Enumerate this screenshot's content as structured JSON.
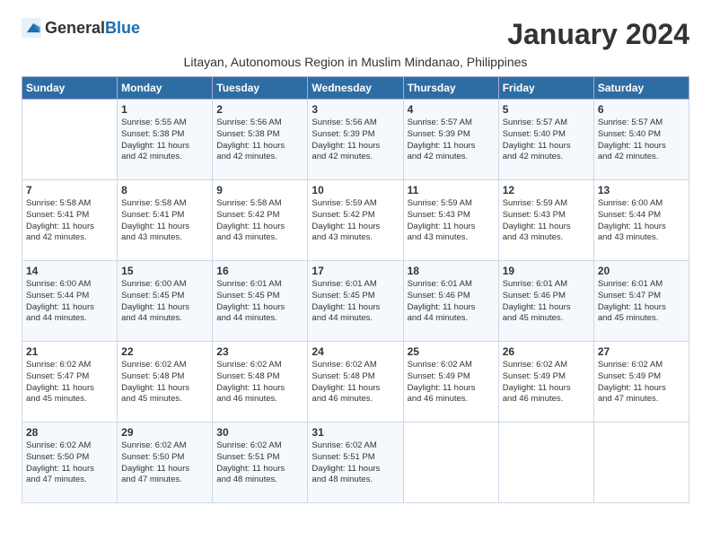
{
  "logo": {
    "general": "General",
    "blue": "Blue"
  },
  "title": "January 2024",
  "subtitle": "Litayan, Autonomous Region in Muslim Mindanao, Philippines",
  "days_of_week": [
    "Sunday",
    "Monday",
    "Tuesday",
    "Wednesday",
    "Thursday",
    "Friday",
    "Saturday"
  ],
  "weeks": [
    [
      {
        "day": "",
        "info": ""
      },
      {
        "day": "1",
        "info": "Sunrise: 5:55 AM\nSunset: 5:38 PM\nDaylight: 11 hours\nand 42 minutes."
      },
      {
        "day": "2",
        "info": "Sunrise: 5:56 AM\nSunset: 5:38 PM\nDaylight: 11 hours\nand 42 minutes."
      },
      {
        "day": "3",
        "info": "Sunrise: 5:56 AM\nSunset: 5:39 PM\nDaylight: 11 hours\nand 42 minutes."
      },
      {
        "day": "4",
        "info": "Sunrise: 5:57 AM\nSunset: 5:39 PM\nDaylight: 11 hours\nand 42 minutes."
      },
      {
        "day": "5",
        "info": "Sunrise: 5:57 AM\nSunset: 5:40 PM\nDaylight: 11 hours\nand 42 minutes."
      },
      {
        "day": "6",
        "info": "Sunrise: 5:57 AM\nSunset: 5:40 PM\nDaylight: 11 hours\nand 42 minutes."
      }
    ],
    [
      {
        "day": "7",
        "info": "Sunrise: 5:58 AM\nSunset: 5:41 PM\nDaylight: 11 hours\nand 42 minutes."
      },
      {
        "day": "8",
        "info": "Sunrise: 5:58 AM\nSunset: 5:41 PM\nDaylight: 11 hours\nand 43 minutes."
      },
      {
        "day": "9",
        "info": "Sunrise: 5:58 AM\nSunset: 5:42 PM\nDaylight: 11 hours\nand 43 minutes."
      },
      {
        "day": "10",
        "info": "Sunrise: 5:59 AM\nSunset: 5:42 PM\nDaylight: 11 hours\nand 43 minutes."
      },
      {
        "day": "11",
        "info": "Sunrise: 5:59 AM\nSunset: 5:43 PM\nDaylight: 11 hours\nand 43 minutes."
      },
      {
        "day": "12",
        "info": "Sunrise: 5:59 AM\nSunset: 5:43 PM\nDaylight: 11 hours\nand 43 minutes."
      },
      {
        "day": "13",
        "info": "Sunrise: 6:00 AM\nSunset: 5:44 PM\nDaylight: 11 hours\nand 43 minutes."
      }
    ],
    [
      {
        "day": "14",
        "info": "Sunrise: 6:00 AM\nSunset: 5:44 PM\nDaylight: 11 hours\nand 44 minutes."
      },
      {
        "day": "15",
        "info": "Sunrise: 6:00 AM\nSunset: 5:45 PM\nDaylight: 11 hours\nand 44 minutes."
      },
      {
        "day": "16",
        "info": "Sunrise: 6:01 AM\nSunset: 5:45 PM\nDaylight: 11 hours\nand 44 minutes."
      },
      {
        "day": "17",
        "info": "Sunrise: 6:01 AM\nSunset: 5:45 PM\nDaylight: 11 hours\nand 44 minutes."
      },
      {
        "day": "18",
        "info": "Sunrise: 6:01 AM\nSunset: 5:46 PM\nDaylight: 11 hours\nand 44 minutes."
      },
      {
        "day": "19",
        "info": "Sunrise: 6:01 AM\nSunset: 5:46 PM\nDaylight: 11 hours\nand 45 minutes."
      },
      {
        "day": "20",
        "info": "Sunrise: 6:01 AM\nSunset: 5:47 PM\nDaylight: 11 hours\nand 45 minutes."
      }
    ],
    [
      {
        "day": "21",
        "info": "Sunrise: 6:02 AM\nSunset: 5:47 PM\nDaylight: 11 hours\nand 45 minutes."
      },
      {
        "day": "22",
        "info": "Sunrise: 6:02 AM\nSunset: 5:48 PM\nDaylight: 11 hours\nand 45 minutes."
      },
      {
        "day": "23",
        "info": "Sunrise: 6:02 AM\nSunset: 5:48 PM\nDaylight: 11 hours\nand 46 minutes."
      },
      {
        "day": "24",
        "info": "Sunrise: 6:02 AM\nSunset: 5:48 PM\nDaylight: 11 hours\nand 46 minutes."
      },
      {
        "day": "25",
        "info": "Sunrise: 6:02 AM\nSunset: 5:49 PM\nDaylight: 11 hours\nand 46 minutes."
      },
      {
        "day": "26",
        "info": "Sunrise: 6:02 AM\nSunset: 5:49 PM\nDaylight: 11 hours\nand 46 minutes."
      },
      {
        "day": "27",
        "info": "Sunrise: 6:02 AM\nSunset: 5:49 PM\nDaylight: 11 hours\nand 47 minutes."
      }
    ],
    [
      {
        "day": "28",
        "info": "Sunrise: 6:02 AM\nSunset: 5:50 PM\nDaylight: 11 hours\nand 47 minutes."
      },
      {
        "day": "29",
        "info": "Sunrise: 6:02 AM\nSunset: 5:50 PM\nDaylight: 11 hours\nand 47 minutes."
      },
      {
        "day": "30",
        "info": "Sunrise: 6:02 AM\nSunset: 5:51 PM\nDaylight: 11 hours\nand 48 minutes."
      },
      {
        "day": "31",
        "info": "Sunrise: 6:02 AM\nSunset: 5:51 PM\nDaylight: 11 hours\nand 48 minutes."
      },
      {
        "day": "",
        "info": ""
      },
      {
        "day": "",
        "info": ""
      },
      {
        "day": "",
        "info": ""
      }
    ]
  ]
}
